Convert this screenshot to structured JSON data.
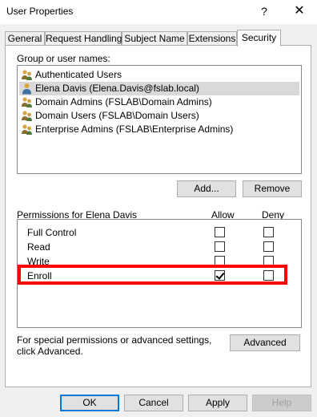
{
  "window": {
    "title": "User Properties",
    "help_glyph": "?",
    "close_glyph": "✕"
  },
  "tabs": [
    {
      "label": "General"
    },
    {
      "label": "Request Handling"
    },
    {
      "label": "Subject Name"
    },
    {
      "label": "Extensions"
    },
    {
      "label": "Security",
      "active": true
    }
  ],
  "security": {
    "group_label": "Group or user names:",
    "principals": [
      {
        "name": "Authenticated Users",
        "icon": "group-icon"
      },
      {
        "name": "Elena Davis (Elena.Davis@fslab.local)",
        "icon": "user-icon",
        "selected": true
      },
      {
        "name": "Domain Admins (FSLAB\\Domain Admins)",
        "icon": "group-icon"
      },
      {
        "name": "Domain Users (FSLAB\\Domain Users)",
        "icon": "group-icon"
      },
      {
        "name": "Enterprise Admins (FSLAB\\Enterprise Admins)",
        "icon": "group-icon"
      }
    ],
    "add_label": "Add...",
    "remove_label": "Remove",
    "permissions_label": "Permissions for Elena Davis",
    "allow_header": "Allow",
    "deny_header": "Deny",
    "permissions": [
      {
        "name": "Full Control",
        "allow": false,
        "deny": false
      },
      {
        "name": "Read",
        "allow": false,
        "deny": false
      },
      {
        "name": "Write",
        "allow": false,
        "deny": false
      },
      {
        "name": "Enroll",
        "allow": true,
        "deny": false
      }
    ],
    "advanced_text": "For special permissions or advanced settings, click Advanced.",
    "advanced_label": "Advanced"
  },
  "footer": {
    "ok": "OK",
    "cancel": "Cancel",
    "apply": "Apply",
    "help": "Help"
  },
  "colors": {
    "highlight": "#ff0000",
    "selection": "#d9d9d9",
    "default_button_border": "#0078d7"
  }
}
